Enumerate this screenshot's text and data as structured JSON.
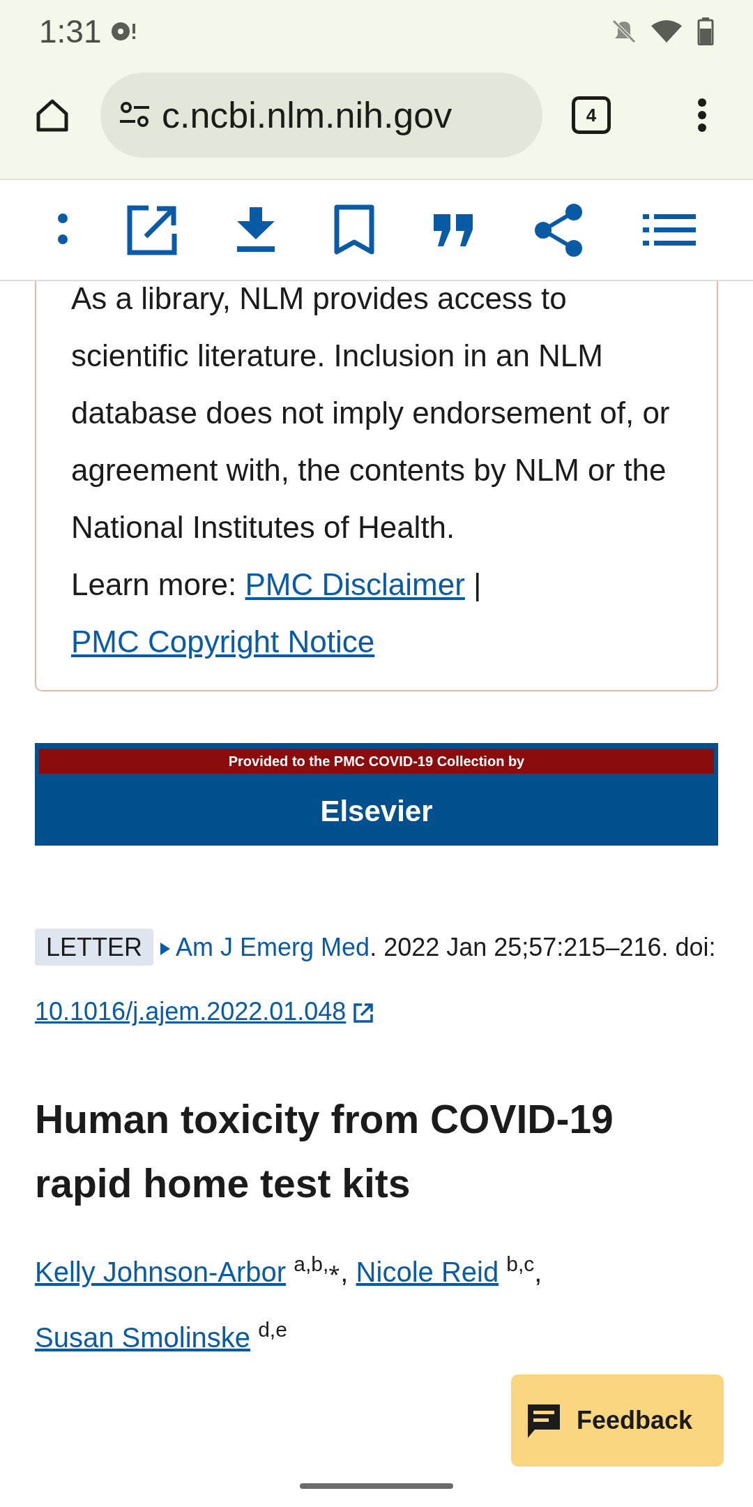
{
  "status_bar": {
    "time": "1:31"
  },
  "browser": {
    "url": "c.ncbi.nlm.nih.gov",
    "tab_count": "4"
  },
  "disclaimer": {
    "text": "As a library, NLM provides access to scientific literature. Inclusion in an NLM database does not imply endorsement of, or agreement with, the contents by NLM or the National Institutes of Health.",
    "learn_more": "Learn more:",
    "links": [
      "PMC Disclaimer",
      "PMC Copyright Notice"
    ],
    "separator": "|"
  },
  "banner": {
    "strip": "Provided to the PMC COVID-19 Collection by",
    "publisher": "Elsevier"
  },
  "citation": {
    "badge": "LETTER",
    "journal": "Am J Emerg Med",
    "details": ". 2022 Jan 25;57:215–216. doi:",
    "doi": "10.1016/j.ajem.2022.01.048"
  },
  "title": "Human toxicity from COVID-19 rapid home test kits",
  "authors": [
    {
      "name": "Kelly Johnson-Arbor",
      "affiliations": "a,b,⁎",
      "separator": ","
    },
    {
      "name": "Nicole Reid",
      "affiliations": "b,c",
      "separator": ","
    },
    {
      "name": "Susan Smolinske",
      "affiliations": "d,e"
    }
  ],
  "feedback_button": "Feedback"
}
